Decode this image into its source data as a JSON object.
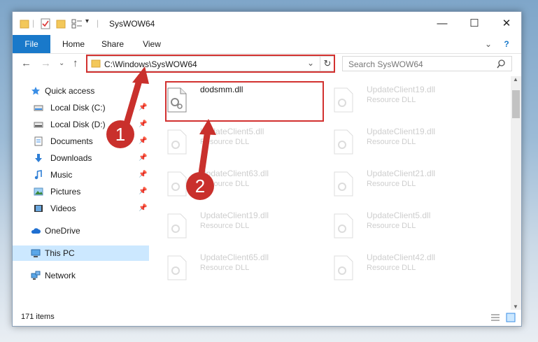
{
  "window": {
    "title": "SysWOW64",
    "minimize": "—",
    "maximize": "☐",
    "close": "✕"
  },
  "ribbon": {
    "tabs": [
      "File",
      "Home",
      "Share",
      "View"
    ],
    "help": "?",
    "expand": "⌄"
  },
  "address": {
    "path": "C:\\Windows\\SysWOW64",
    "back": "←",
    "forward": "→",
    "recent": "⌄",
    "up": "↑",
    "dropdown": "⌄",
    "refresh": "↻",
    "search_placeholder": "Search SysWOW64"
  },
  "nav": {
    "items": [
      {
        "label": "Quick access",
        "icon": "star-icon",
        "pinned": false
      },
      {
        "label": "Local Disk (C:)",
        "icon": "disk-icon",
        "pinned": true
      },
      {
        "label": "Local Disk (D:)",
        "icon": "disk-icon",
        "pinned": true
      },
      {
        "label": "Documents",
        "icon": "documents-icon",
        "pinned": true
      },
      {
        "label": "Downloads",
        "icon": "downloads-icon",
        "pinned": true
      },
      {
        "label": "Music",
        "icon": "music-icon",
        "pinned": true
      },
      {
        "label": "Pictures",
        "icon": "pictures-icon",
        "pinned": true
      },
      {
        "label": "Videos",
        "icon": "videos-icon",
        "pinned": true
      },
      {
        "label": "OneDrive",
        "icon": "cloud-icon",
        "pinned": false
      },
      {
        "label": "This PC",
        "icon": "computer-icon",
        "pinned": false
      },
      {
        "label": "Network",
        "icon": "network-icon",
        "pinned": false
      }
    ],
    "selected": "This PC"
  },
  "files": [
    {
      "name": "dodsmm.dll",
      "type": ""
    },
    {
      "name": "UpdateClient19.dll",
      "type": "Resource DLL"
    },
    {
      "name": "UpdateClient5.dll",
      "type": "Resource DLL"
    },
    {
      "name": "UpdateClient19.dll",
      "type": "Resource DLL"
    },
    {
      "name": "UpdateClient63.dll",
      "type": "Resource DLL"
    },
    {
      "name": "UpdateClient21.dll",
      "type": "Resource DLL"
    },
    {
      "name": "UpdateClient19.dll",
      "type": "Resource DLL"
    },
    {
      "name": "UpdateClient5.dll",
      "type": "Resource DLL"
    },
    {
      "name": "UpdateClient65.dll",
      "type": "Resource DLL"
    },
    {
      "name": "UpdateClient42.dll",
      "type": "Resource DLL"
    }
  ],
  "status": {
    "count": "171 items"
  },
  "annotations": {
    "step1": "1",
    "step2": "2"
  },
  "colors": {
    "accent": "#1979ca",
    "annotation_red": "#d2312f",
    "selection": "#cce8ff"
  }
}
